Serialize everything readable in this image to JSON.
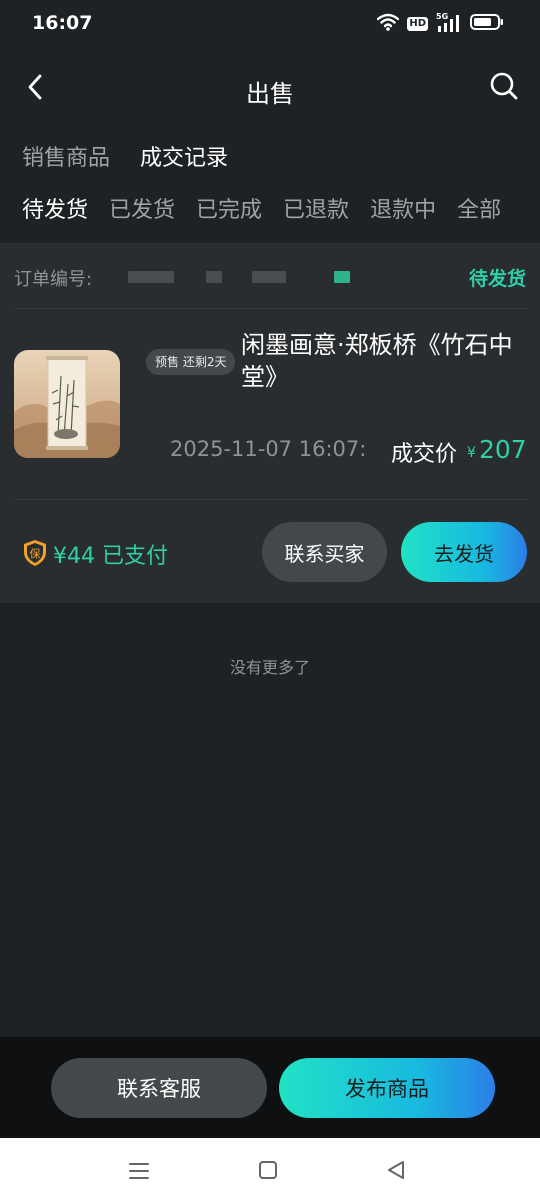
{
  "status_bar": {
    "time": "16:07",
    "network_badge": "HD",
    "signal_label": "5G",
    "icons": [
      "wifi-icon",
      "hd-icon",
      "signal-icon",
      "battery-icon"
    ]
  },
  "header": {
    "title": "出售",
    "back_icon": "chevron-left-icon",
    "search_icon": "search-icon"
  },
  "main_tabs": [
    {
      "label": "销售商品",
      "active": false
    },
    {
      "label": "成交记录",
      "active": true
    }
  ],
  "sub_tabs": [
    {
      "label": "待发货",
      "active": true
    },
    {
      "label": "已发货",
      "active": false
    },
    {
      "label": "已完成",
      "active": false
    },
    {
      "label": "已退款",
      "active": false
    },
    {
      "label": "退款中",
      "active": false
    },
    {
      "label": "全部",
      "active": false
    }
  ],
  "order": {
    "order_no_label": "订单编号:",
    "status": "待发货",
    "presale_badge": "预售 还剩2天",
    "title": "闲墨画意·郑板桥《竹石中堂》",
    "deal_time": "2025-11-07 16:07:",
    "price_label": "成交价",
    "currency": "¥",
    "price": "207",
    "deposit_icon_label": "保",
    "deposit_text": "¥44 已支付",
    "contact_buyer_button": "联系买家",
    "ship_button": "去发货"
  },
  "no_more_text": "没有更多了",
  "bottom_bar": {
    "service_button": "联系客服",
    "publish_button": "发布商品"
  },
  "colors": {
    "background": "#1f2224",
    "card": "#2a2d2f",
    "accent": "#2fd0a6",
    "button_dark": "#44484b",
    "gradient_start": "#21e2c5",
    "gradient_end": "#2c7ee6",
    "shield_orange": "#f2a229"
  }
}
